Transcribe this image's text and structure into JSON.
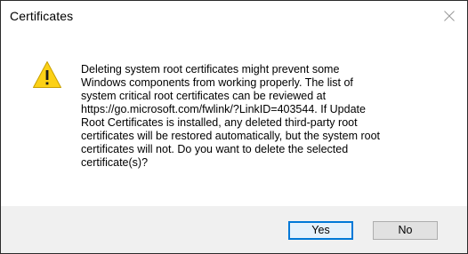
{
  "window": {
    "title": "Certificates",
    "close_icon": "close-icon"
  },
  "content": {
    "icon": "warning-icon",
    "message": "Deleting system root certificates might prevent some\nWindows components from working properly. The list of\nsystem critical root certificates can be reviewed at\nhttps://go.microsoft.com/fwlink/?LinkID=403544. If Update\nRoot Certificates is installed, any deleted third-party root\ncertificates will be restored automatically, but the system root\ncertificates will not. Do you want to delete the selected\ncertificate(s)?"
  },
  "buttons": {
    "yes_label": "Yes",
    "no_label": "No"
  },
  "colors": {
    "warning_fill": "#fcd116",
    "default_button_border": "#0078d7",
    "footer_background": "#f0f0f0"
  }
}
